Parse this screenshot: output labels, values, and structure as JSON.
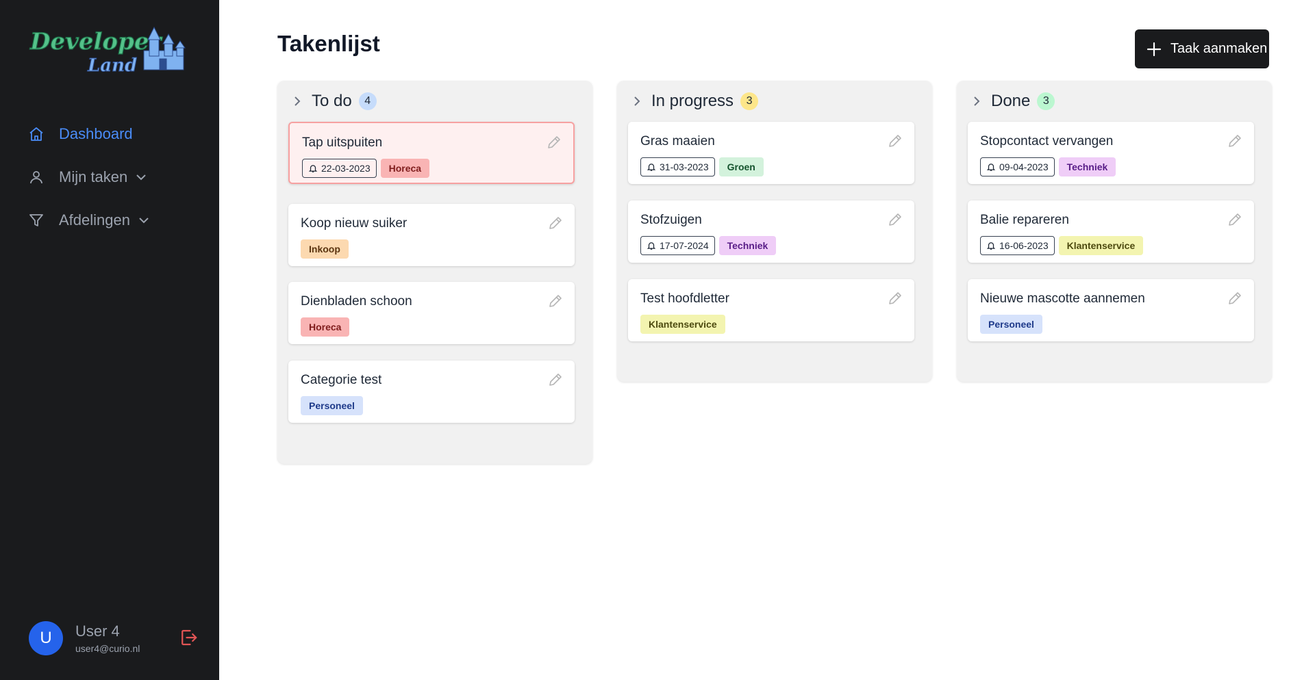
{
  "sidebar": {
    "logo_text_line1": "Developer",
    "logo_text_line2": "Land",
    "nav": [
      {
        "label": "Dashboard",
        "icon": "home-icon",
        "active": true
      },
      {
        "label": "Mijn taken",
        "icon": "user-icon",
        "active": false
      },
      {
        "label": "Afdelingen",
        "icon": "filter-icon",
        "active": false
      }
    ],
    "user": {
      "initial": "U",
      "name": "User 4",
      "email": "user4@curio.nl"
    }
  },
  "main": {
    "title": "Takenlijst",
    "create_button": "Taak aanmaken",
    "columns": [
      {
        "title": "To do",
        "count": "4",
        "count_color": "#c6dcfb",
        "cards": [
          {
            "title": "Tap uitspuiten",
            "date": "22-03-2023",
            "tag": "Horeca",
            "highlight": true
          },
          {
            "title": "Koop nieuw suiker",
            "date": null,
            "tag": "Inkoop"
          },
          {
            "title": "Dienbladen schoon",
            "date": null,
            "tag": "Horeca"
          },
          {
            "title": "Categorie test",
            "date": null,
            "tag": "Personeel"
          }
        ]
      },
      {
        "title": "In progress",
        "count": "3",
        "count_color": "#fde68a",
        "cards": [
          {
            "title": "Gras maaien",
            "date": "31-03-2023",
            "tag": "Groen"
          },
          {
            "title": "Stofzuigen",
            "date": "17-07-2024",
            "tag": "Techniek"
          },
          {
            "title": "Test hoofdletter",
            "date": null,
            "tag": "Klantenservice"
          }
        ]
      },
      {
        "title": "Done",
        "count": "3",
        "count_color": "#bbf7d0",
        "cards": [
          {
            "title": "Stopcontact vervangen",
            "date": "09-04-2023",
            "tag": "Techniek"
          },
          {
            "title": "Balie repareren",
            "date": "16-06-2023",
            "tag": "Klantenservice"
          },
          {
            "title": "Nieuwe mascotte aannemen",
            "date": null,
            "tag": "Personeel"
          }
        ]
      }
    ]
  },
  "tag_colors": {
    "Horeca": {
      "bg": "#f9b4b4",
      "fg": "#7f1d1d"
    },
    "Inkoop": {
      "bg": "#fcd9b0",
      "fg": "#5b3410"
    },
    "Personeel": {
      "bg": "#d6e2fb",
      "fg": "#1e3a8a"
    },
    "Groen": {
      "bg": "#d3f2dc",
      "fg": "#14532d"
    },
    "Techniek": {
      "bg": "#efcdf7",
      "fg": "#581c87"
    },
    "Klantenservice": {
      "bg": "#f3f4b0",
      "fg": "#4d4a0f"
    }
  }
}
